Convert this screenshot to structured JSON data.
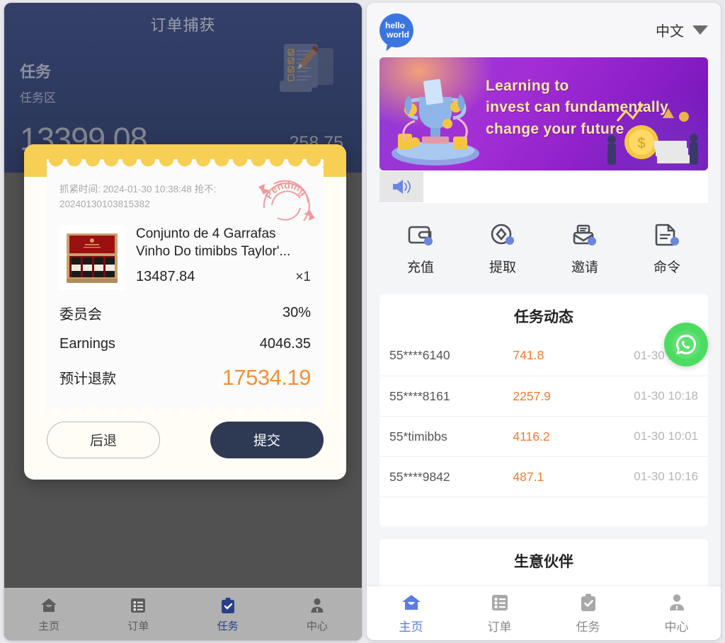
{
  "left_panel": {
    "header": {
      "title": "订单捕获",
      "task_label": "任务",
      "task_sub": "任务区",
      "amount_main": "13399.08",
      "amount_secondary": "258.75",
      "clipboard_icon": "clipboard-checklist-icon"
    },
    "modal": {
      "deadline_text": "抓紧时间: 2024-01-30 10:38:48 抢不: 20240130103815382",
      "stamp_text": "Pending",
      "product": {
        "name": "Conjunto de 4 Garrafas Vinho Do timibbs Taylor'...",
        "price": "13487.84",
        "quantity": "×1",
        "image_icon": "wine-box-image"
      },
      "rows": [
        {
          "key": "委员会",
          "value": "30%"
        },
        {
          "key": "Earnings",
          "value": "4046.35"
        }
      ],
      "total": {
        "key": "预计退款",
        "value": "17534.19"
      },
      "back_button": "后退",
      "submit_button": "提交"
    },
    "nav": {
      "items": [
        {
          "label": "主页",
          "icon": "home-icon",
          "active": false
        },
        {
          "label": "订单",
          "icon": "list-icon",
          "active": false
        },
        {
          "label": "任务",
          "icon": "clipboard-check-icon",
          "active": true
        },
        {
          "label": "中心",
          "icon": "user-icon",
          "active": false
        }
      ]
    }
  },
  "right_panel": {
    "header": {
      "logo_line1": "hello",
      "logo_line2": "world",
      "language": "中文",
      "caret_icon": "chevron-down-icon"
    },
    "banner": {
      "line1": "Learning to",
      "line2": "invest can fundamentally",
      "line3": "change your future"
    },
    "notice": {
      "speaker_icon": "speaker-icon"
    },
    "quick_actions": [
      {
        "label": "充值",
        "icon": "wallet-icon"
      },
      {
        "label": "提取",
        "icon": "withdraw-diamond-icon"
      },
      {
        "label": "邀请",
        "icon": "envelope-icon"
      },
      {
        "label": "命令",
        "icon": "document-icon"
      }
    ],
    "task_dynamics": {
      "title": "任务动态",
      "rows": [
        {
          "user": "55****6140",
          "amount": "741.8",
          "time": "01-30 10:19"
        },
        {
          "user": "55****8161",
          "amount": "2257.9",
          "time": "01-30 10:18"
        },
        {
          "user": "55*timibbs",
          "amount": "4116.2",
          "time": "01-30 10:01"
        },
        {
          "user": "55****9842",
          "amount": "487.1",
          "time": "01-30 10:16"
        }
      ]
    },
    "partners": {
      "title": "生意伙伴"
    },
    "whatsapp_float": {
      "icon": "whatsapp-icon"
    },
    "nav": {
      "items": [
        {
          "label": "主页",
          "icon": "home-icon",
          "active": true
        },
        {
          "label": "订单",
          "icon": "list-icon",
          "active": false
        },
        {
          "label": "任务",
          "icon": "clipboard-check-icon",
          "active": false
        },
        {
          "label": "中心",
          "icon": "user-icon",
          "active": false
        }
      ]
    }
  },
  "colors": {
    "left_header_bg": "#2d3a5c",
    "modal_band": "#f7cf54",
    "accent_orange": "#f29138",
    "dyn_amount": "#f47b30",
    "nav_active_left": "#2a3f86",
    "nav_active_right": "#5b7ce0",
    "banner_text": "#ffe9a8",
    "logo_blue": "#3b76e0",
    "whatsapp_green": "#4ddc62"
  }
}
